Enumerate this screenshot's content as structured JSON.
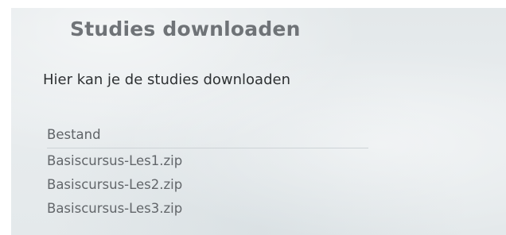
{
  "page": {
    "title": "Studies downloaden",
    "intro": "Hier kan je de studies downloaden"
  },
  "table": {
    "header": "Bestand",
    "rows": [
      "Basiscursus-Les1.zip",
      "Basiscursus-Les2.zip",
      "Basiscursus-Les3.zip"
    ]
  }
}
